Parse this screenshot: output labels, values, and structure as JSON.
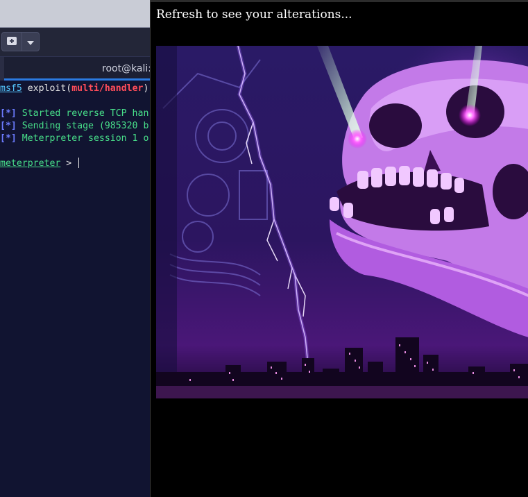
{
  "terminal": {
    "title": "root@kali:",
    "toolbar": {
      "new_tab_icon": "new-tab-icon",
      "dropdown_icon": "chevron-down-icon"
    },
    "lines": {
      "l1_prompt": "msf5",
      "l1_cmd": " exploit(",
      "l1_module": "multi/handler",
      "l1_end": ")",
      "l2_tag": "[*]",
      "l2_text": " Started reverse TCP han",
      "l3_tag": "[*]",
      "l3_text": " Sending stage (985320 b",
      "l4_tag": "[*]",
      "l4_text": " Meterpreter session 1 o",
      "l5_prompt": "meterpreter",
      "l5_caret": " > "
    },
    "colors": {
      "background": "#111431",
      "accent": "#2b7ae0",
      "module": "#ff4d5a",
      "status": "#48e08a",
      "tag": "#6c7cff"
    }
  },
  "popup": {
    "message": "Refresh to see your alterations...",
    "image": "purple-skull-lightning-city-art",
    "background": "#000000"
  }
}
